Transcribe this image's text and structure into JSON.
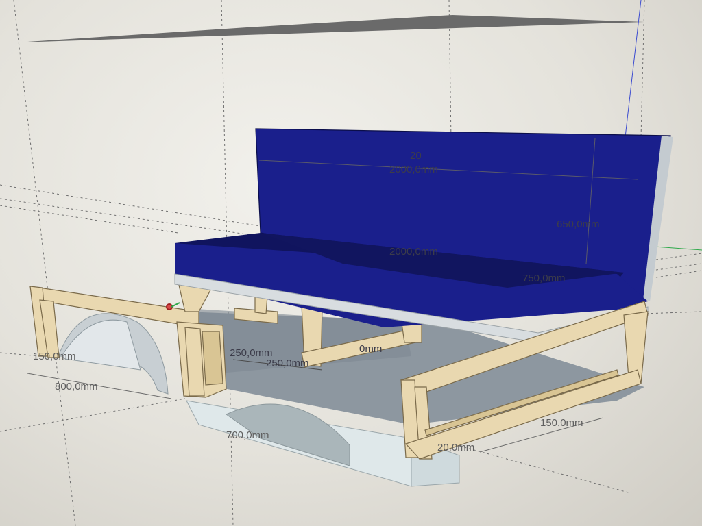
{
  "viewport_label": "SketchUp-style 3D model viewport",
  "dimensions": {
    "backrest_width_small": "20",
    "backrest_width": "2000,0mm",
    "backrest_height": "650,0mm",
    "seat_width": "2000,0mm",
    "seat_depth": "750,0mm",
    "frame_length": "800,0mm",
    "left_small": "150,0mm",
    "inner_a": "250,0mm",
    "inner_b": "250,0mm",
    "inner_c": "0mm",
    "base_depth": "700,0mm",
    "right_offset": "150,0mm",
    "bottom_right": "20,0mm"
  },
  "colors": {
    "cushion": "#1a1f8c",
    "cushion_top": "#10145e",
    "wood": "#e9d8b0",
    "wood_edge": "#7a6a4a",
    "base": "#dfe8ea",
    "floor": "#8d97a0"
  }
}
